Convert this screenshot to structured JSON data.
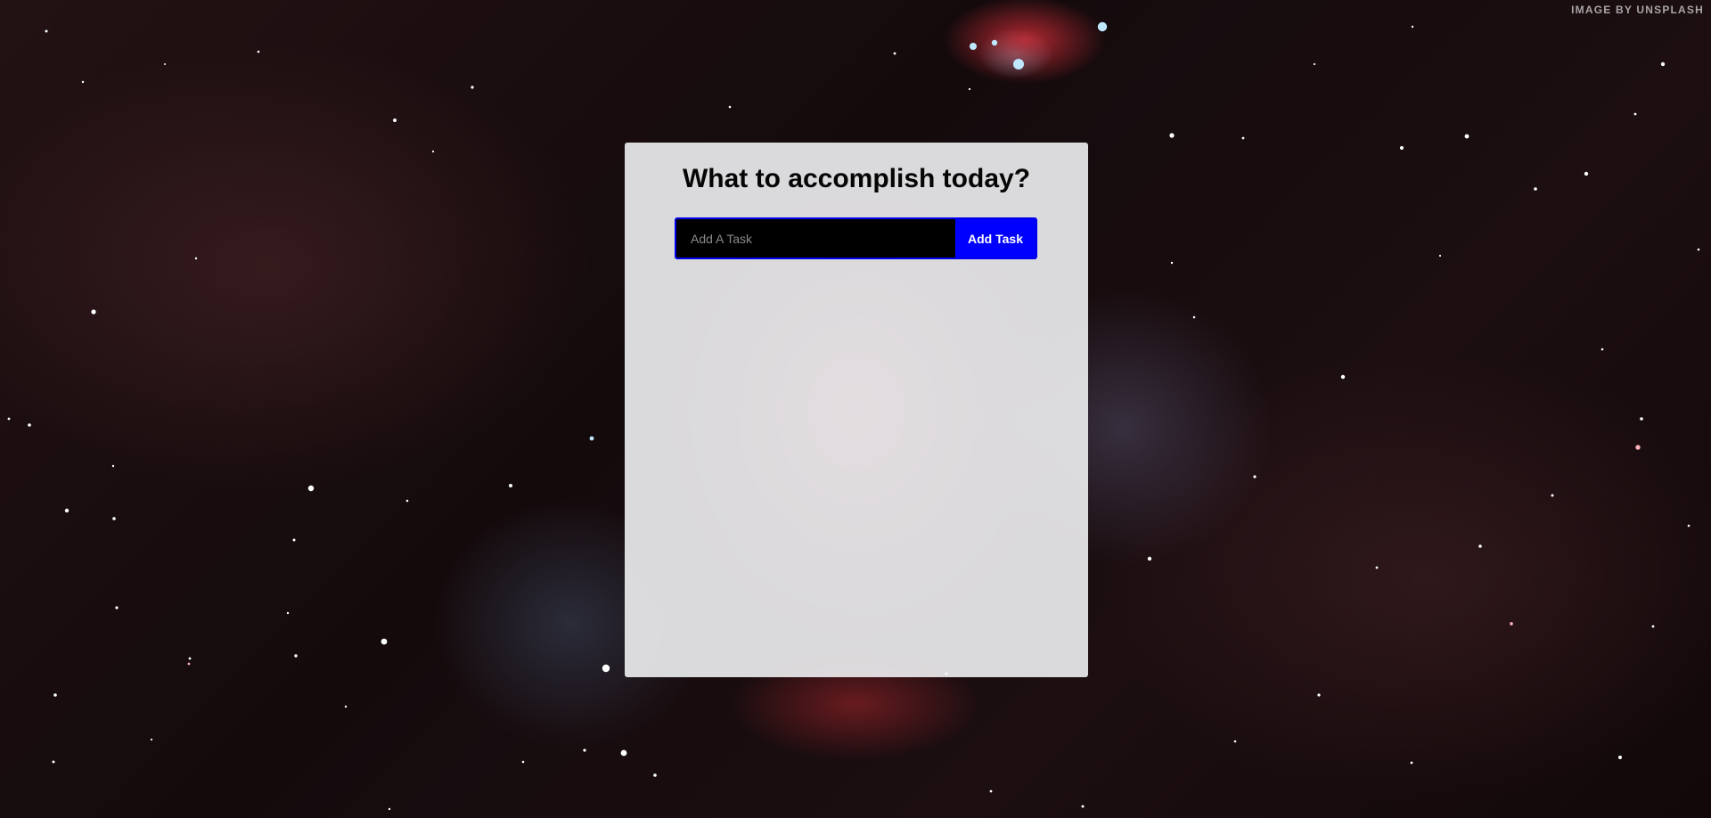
{
  "background": {
    "credit": "IMAGE BY UNSPLASH"
  },
  "card": {
    "title": "What to accomplish today?",
    "input_placeholder": "Add A Task",
    "input_value": "",
    "add_button_label": "Add Task"
  },
  "colors": {
    "accent": "#0000ff",
    "input_background": "#000000",
    "card_background": "#f0f0f2"
  }
}
